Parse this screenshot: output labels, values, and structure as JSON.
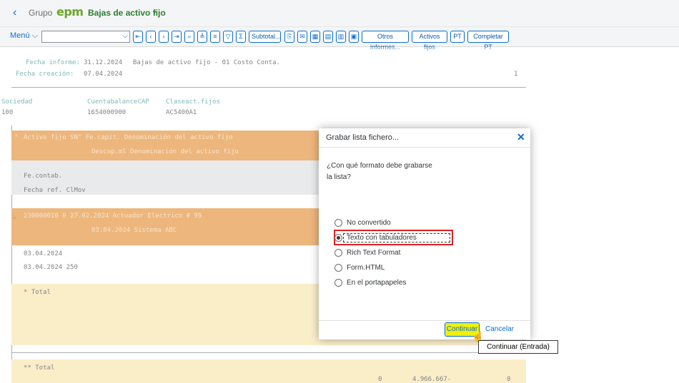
{
  "header": {
    "back_icon": "chevron-left-icon",
    "company": "Grupo",
    "logo": "epm",
    "app_title": "Bajas de activo fijo",
    "app_caret": "▾"
  },
  "toolbar": {
    "menu_label": "Menú",
    "select_value": "",
    "icon_buttons": [
      "first-page-icon",
      "previous-page-icon",
      "next-page-icon",
      "last-page-icon",
      "find-icon",
      "sort-ascending-icon",
      "sort-descending-icon",
      "filter-icon",
      "sum-icon"
    ],
    "icon_glyphs": [
      "⇤",
      "‹",
      "›",
      "⇥",
      "⌕",
      "≜",
      "≡",
      "▽",
      "Σ"
    ],
    "subtotal_label": "Subtotal...",
    "action_icons": [
      "print-icon",
      "mail-icon",
      "spreadsheet-icon",
      "layout-icon",
      "layout-change-icon",
      "export-icon"
    ],
    "action_glyphs": [
      "⎘",
      "✉",
      "▦",
      "▤",
      "▥",
      "▣"
    ],
    "other_reports_label": "Otros informes...",
    "fixed_assets_label": "Activos fijos",
    "pt_label": "PT",
    "complete_pt_label": "Completar PT"
  },
  "report": {
    "fecha_informe_label": "Fecha informe:",
    "fecha_informe_value": "31.12.2024",
    "report_title": "Bajas de activo fijo - 01 Costo Conta.",
    "fecha_creacion_label": "Fecha creación:",
    "fecha_creacion_value": "07.04.2024",
    "page_number": "1",
    "col_sociedad": "Sociedad",
    "col_cuenta": "CuentabalanceCAP",
    "col_clase": "Claseact.fijos",
    "val_sociedad": "100",
    "val_cuenta": "1654000900",
    "val_clase": "AC5400A1",
    "header_row1": "Activo fijo  SN°  Fe.capit.  Denominación del activo fijo",
    "header_row2": "Descap.ml  Denominación del activo fijo",
    "fe_contab": "Fe.contab.",
    "fecha_ref": "Fecha ref. ClMov",
    "asset_row1": "230000010    0    27.02.2024 Actuador Electrico # 99",
    "asset_row2": "03.04.2024 Sistema ABC",
    "date_row1": "03.04.2024",
    "date_row2": "03.04.2024 250",
    "total1": "* Total",
    "total2": "** Total",
    "bottom_val1": "0",
    "bottom_val2": "4.966.667-",
    "bottom_val3": "0"
  },
  "dialog": {
    "title": "Grabar lista fichero...",
    "close_icon": "close-icon",
    "question_line1": "¿Con qué formato debe grabarse",
    "question_line2": "la lista?",
    "options": [
      {
        "label": "No convertido",
        "selected": false
      },
      {
        "label": "Texto con tabuladores",
        "selected": true
      },
      {
        "label": "Rich Text Format",
        "selected": false
      },
      {
        "label": "Form.HTML",
        "selected": false
      },
      {
        "label": "En el portapapeles",
        "selected": false
      }
    ],
    "continue_label": "Continuar",
    "cancel_label": "Cancelar",
    "tooltip": "Continuar (Entrada)"
  }
}
